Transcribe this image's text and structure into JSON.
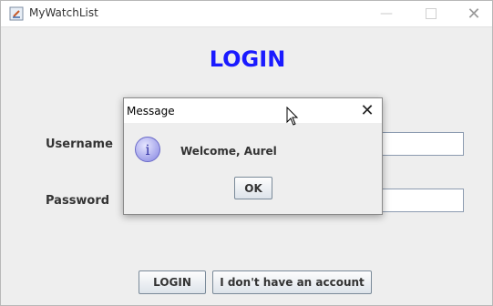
{
  "window": {
    "title": "MyWatchList"
  },
  "login": {
    "heading": "LOGIN",
    "username_label": "Username",
    "password_label": "Password",
    "username_value": "",
    "password_value": "",
    "login_button": "LOGIN",
    "no_account_button": "I don't have an account"
  },
  "dialog": {
    "title": "Message",
    "close_glyph": "✕",
    "icon": "info-icon",
    "message": "Welcome, Aurel",
    "ok_button": "OK"
  },
  "colors": {
    "heading": "#1a1aff",
    "window_bg": "#eeeeee",
    "info_icon": "#9c9ce8"
  }
}
